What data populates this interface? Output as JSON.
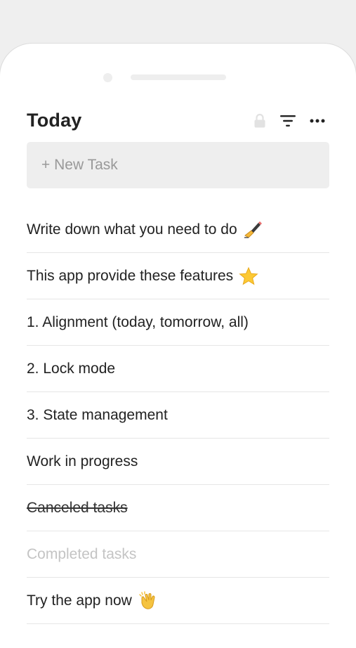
{
  "header": {
    "title": "Today",
    "icons": [
      "lock-icon",
      "filter-icon",
      "more-icon"
    ]
  },
  "new_task": {
    "label": "+ New Task"
  },
  "tasks": [
    {
      "text": "Write down what you need to do",
      "state": "normal",
      "icon": "writing-hand-icon"
    },
    {
      "text": "This app provide these features",
      "state": "normal",
      "icon": "star-icon"
    },
    {
      "text": "1. Alignment (today, tomorrow, all)",
      "state": "normal"
    },
    {
      "text": "2. Lock mode",
      "state": "normal"
    },
    {
      "text": "3. State management",
      "state": "normal"
    },
    {
      "text": "Work in progress",
      "state": "in-progress"
    },
    {
      "text": "Canceled tasks",
      "state": "canceled"
    },
    {
      "text": "Completed tasks",
      "state": "completed"
    },
    {
      "text": "Try the app now",
      "state": "normal",
      "icon": "clapping-hands-icon"
    }
  ],
  "colors": {
    "background": "#efefef",
    "card": "#ffffff",
    "text": "#222222",
    "muted": "#999999",
    "completed": "#c4c4c4",
    "input_bg": "#eeeeee"
  }
}
